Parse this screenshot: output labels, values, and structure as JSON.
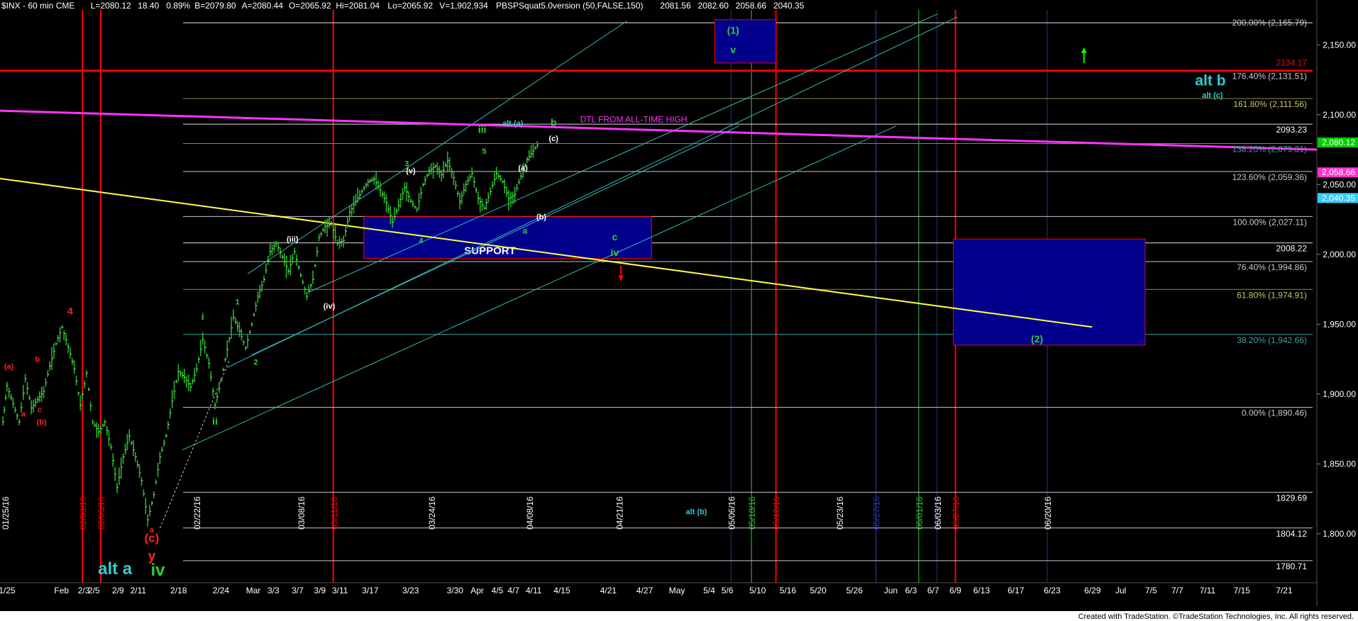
{
  "header": {
    "segments": [
      {
        "text": "$INX - 60 min  CME",
        "color": "#ffffff"
      },
      {
        "text": "L=2080.12",
        "color": "#ffffff"
      },
      {
        "text": "18.40",
        "color": "#ffffff"
      },
      {
        "text": "0.89%",
        "color": "#ffffff"
      },
      {
        "text": "B=2079.80",
        "color": "#ffffff"
      },
      {
        "text": "A=2080.44",
        "color": "#ffffff"
      },
      {
        "text": "O=2065.92",
        "color": "#ffffff"
      },
      {
        "text": "Hi=2081.04",
        "color": "#ffffff"
      },
      {
        "text": "Lo=2065.92",
        "color": "#ffffff"
      },
      {
        "text": "V=1,902,934",
        "color": "#ffffff"
      },
      {
        "text": "PBSPSquat5.0version (50,FALSE,150)",
        "color": "#ffffff"
      },
      {
        "text": "2081.56",
        "color": "#33ccff"
      },
      {
        "text": "2082.60",
        "color": "#cccc00"
      },
      {
        "text": "2058.66",
        "color": "#ff33cc"
      },
      {
        "text": "2040.35",
        "color": "#33ccff"
      }
    ]
  },
  "footer": {
    "text": "Created with TradeStation. ©TradeStation Technologies, Inc. All rights reserved."
  },
  "chart_data": {
    "type": "candlestick",
    "symbol": "$INX",
    "interval": "60 min",
    "ylim": [
      1770,
      2175
    ],
    "y_ticks": [
      "2,150.00",
      "2,100.00",
      "2,050.00",
      "2,000.00",
      "1,950.00",
      "1,900.00",
      "1,850.00",
      "1,800.00"
    ],
    "y_tick_values": [
      2150,
      2100,
      2050,
      2000,
      1950,
      1900,
      1850,
      1800
    ],
    "x_tick_labels": [
      "1/25",
      "Feb",
      "2/3",
      "2/5",
      "2/9",
      "2/11",
      "2/18",
      "2/24",
      "Mar",
      "3/3",
      "3/7",
      "3/9",
      "3/11",
      "3/17",
      "3/23",
      "3/30",
      "Apr",
      "4/5",
      "4/7",
      "4/11",
      "4/15",
      "4/21",
      "4/27",
      "May",
      "5/4",
      "5/6",
      "5/10",
      "5/16",
      "5/20",
      "5/26",
      "Jun",
      "6/3",
      "6/7",
      "6/9",
      "6/13",
      "6/17",
      "6/23",
      "6/29",
      "Jul",
      "7/5",
      "7/7",
      "7/11",
      "7/15",
      "7/21"
    ],
    "price_path": [
      {
        "d": 0,
        "p": 1880
      },
      {
        "d": 2,
        "p": 1906
      },
      {
        "d": 5,
        "p": 1893
      },
      {
        "d": 8,
        "p": 1880
      },
      {
        "d": 11,
        "p": 1911
      },
      {
        "d": 14,
        "p": 1890
      },
      {
        "d": 17,
        "p": 1896
      },
      {
        "d": 20,
        "p": 1902
      },
      {
        "d": 23,
        "p": 1920
      },
      {
        "d": 26,
        "p": 1936
      },
      {
        "d": 29,
        "p": 1948
      },
      {
        "d": 32,
        "p": 1934
      },
      {
        "d": 35,
        "p": 1918
      },
      {
        "d": 38,
        "p": 1892
      },
      {
        "d": 41,
        "p": 1915
      },
      {
        "d": 44,
        "p": 1880
      },
      {
        "d": 47,
        "p": 1873
      },
      {
        "d": 50,
        "p": 1880
      },
      {
        "d": 53,
        "p": 1862
      },
      {
        "d": 56,
        "p": 1833
      },
      {
        "d": 59,
        "p": 1855
      },
      {
        "d": 62,
        "p": 1870
      },
      {
        "d": 65,
        "p": 1855
      },
      {
        "d": 68,
        "p": 1838
      },
      {
        "d": 71,
        "p": 1810
      },
      {
        "d": 74,
        "p": 1828
      },
      {
        "d": 77,
        "p": 1855
      },
      {
        "d": 80,
        "p": 1870
      },
      {
        "d": 83,
        "p": 1895
      },
      {
        "d": 86,
        "p": 1916
      },
      {
        "d": 89,
        "p": 1912
      },
      {
        "d": 92,
        "p": 1905
      },
      {
        "d": 95,
        "p": 1918
      },
      {
        "d": 98,
        "p": 1939
      },
      {
        "d": 101,
        "p": 1922
      },
      {
        "d": 104,
        "p": 1892
      },
      {
        "d": 107,
        "p": 1910
      },
      {
        "d": 110,
        "p": 1932
      },
      {
        "d": 113,
        "p": 1955
      },
      {
        "d": 116,
        "p": 1945
      },
      {
        "d": 119,
        "p": 1933
      },
      {
        "d": 122,
        "p": 1950
      },
      {
        "d": 125,
        "p": 1970
      },
      {
        "d": 128,
        "p": 1982
      },
      {
        "d": 131,
        "p": 2002
      },
      {
        "d": 134,
        "p": 2008
      },
      {
        "d": 137,
        "p": 1998
      },
      {
        "d": 140,
        "p": 1988
      },
      {
        "d": 143,
        "p": 2002
      },
      {
        "d": 146,
        "p": 1985
      },
      {
        "d": 149,
        "p": 1970
      },
      {
        "d": 152,
        "p": 1982
      },
      {
        "d": 155,
        "p": 2012
      },
      {
        "d": 158,
        "p": 2020
      },
      {
        "d": 161,
        "p": 2022
      },
      {
        "d": 164,
        "p": 2008
      },
      {
        "d": 167,
        "p": 2010
      },
      {
        "d": 170,
        "p": 2030
      },
      {
        "d": 173,
        "p": 2038
      },
      {
        "d": 176,
        "p": 2045
      },
      {
        "d": 179,
        "p": 2052
      },
      {
        "d": 182,
        "p": 2054
      },
      {
        "d": 185,
        "p": 2046
      },
      {
        "d": 188,
        "p": 2037
      },
      {
        "d": 191,
        "p": 2023
      },
      {
        "d": 194,
        "p": 2035
      },
      {
        "d": 197,
        "p": 2048
      },
      {
        "d": 200,
        "p": 2038
      },
      {
        "d": 203,
        "p": 2032
      },
      {
        "d": 206,
        "p": 2050
      },
      {
        "d": 209,
        "p": 2060
      },
      {
        "d": 212,
        "p": 2063
      },
      {
        "d": 215,
        "p": 2057
      },
      {
        "d": 218,
        "p": 2067
      },
      {
        "d": 221,
        "p": 2055
      },
      {
        "d": 224,
        "p": 2038
      },
      {
        "d": 227,
        "p": 2050
      },
      {
        "d": 230,
        "p": 2058
      },
      {
        "d": 233,
        "p": 2040
      },
      {
        "d": 236,
        "p": 2033
      },
      {
        "d": 239,
        "p": 2045
      },
      {
        "d": 242,
        "p": 2058
      },
      {
        "d": 245,
        "p": 2052
      },
      {
        "d": 248,
        "p": 2040
      },
      {
        "d": 251,
        "p": 2043
      },
      {
        "d": 254,
        "p": 2056
      },
      {
        "d": 257,
        "p": 2068
      },
      {
        "d": 260,
        "p": 2074
      },
      {
        "d": 263,
        "p": 2080
      }
    ],
    "fib_levels": [
      {
        "label": "200.00% (2,165.79)",
        "value": 2165.79,
        "color": "#c8c8c8",
        "line": "#e8e8e8"
      },
      {
        "label": "176.40% (2,131.51)",
        "value": 2131.51,
        "color": "#c8c8c8",
        "line": "#ff0000"
      },
      {
        "label": "161.80% (2,111.56)",
        "value": 2111.56,
        "color": "#c8c864",
        "line": "#8c8c50"
      },
      {
        "label": "2093.23",
        "value": 2093.23,
        "color": "#ffffff",
        "line": "#dcdcdc"
      },
      {
        "label": "138.20% (2,079.31)",
        "value": 2079.31,
        "color": "#46a0a0",
        "line": "#46a0a0"
      },
      {
        "label": "123.60% (2,059.36)",
        "value": 2059.36,
        "color": "#c8c8c8",
        "line": "#c8c8c8"
      },
      {
        "label": "100.00% (2,027.11)",
        "value": 2027.11,
        "color": "#c8c8c8",
        "line": "#c8c8c8"
      },
      {
        "label": "2008.22",
        "value": 2008.22,
        "color": "#ffffff",
        "line": "#dcdcdc"
      },
      {
        "label": "76.40% (1,994.86)",
        "value": 1994.86,
        "color": "#c8c8c8",
        "line": "#c8c8c8"
      },
      {
        "label": "61.80% (1,974.91)",
        "value": 1974.91,
        "color": "#c8c864",
        "line": "#8c8c50"
      },
      {
        "label": "38.20% (1,942.66)",
        "value": 1942.66,
        "color": "#46a0a0",
        "line": "#46a0a0"
      },
      {
        "label": "0.00% (1,890.46)",
        "value": 1890.46,
        "color": "#c8c8c8",
        "line": "#c8c8c8"
      },
      {
        "label": "1829.69",
        "value": 1829.69,
        "color": "#ffffff",
        "line": "#c8c8c8"
      },
      {
        "label": "1804.12",
        "value": 1804.12,
        "color": "#ffffff",
        "line": "#c8c8c8"
      },
      {
        "label": "1780.71",
        "value": 1780.71,
        "color": "#ffffff",
        "line": "#c8c8c8"
      }
    ],
    "price_markers": [
      {
        "text": "2,080.12",
        "value": 2080.12,
        "bg": "#00cc00",
        "fg": "#000000"
      },
      {
        "text": "2,058.66",
        "value": 2058.66,
        "bg": "#ff33cc",
        "fg": "#000000"
      },
      {
        "text": "2,040.35",
        "value": 2040.35,
        "bg": "#33ccff",
        "fg": "#000000"
      }
    ],
    "red_level_label": {
      "text": "2134.17",
      "value": 2134.17,
      "color": "#ff0000"
    },
    "vertical_date_markers": [
      {
        "text": "01/25/16",
        "d": 0,
        "color": "#ffffff",
        "line": null
      },
      {
        "text": "02/03/16",
        "d": 39,
        "color": "#ff0000",
        "line": "#ff0000"
      },
      {
        "text": "02/05/16",
        "d": 48,
        "color": "#ff0000",
        "line": "#ff0000"
      },
      {
        "text": "02/22/16",
        "d": 95,
        "color": "#ffffff",
        "line": null
      },
      {
        "text": "03/08/16",
        "d": 146,
        "color": "#ffffff",
        "line": null
      },
      {
        "text": "03/11/16",
        "d": 162,
        "color": "#ff0000",
        "line": "#ff0000"
      },
      {
        "text": "03/24/16",
        "d": 210,
        "color": "#ffffff",
        "line": null
      },
      {
        "text": "04/08/16",
        "d": 258,
        "color": "#ffffff",
        "line": null
      },
      {
        "text": "04/21/16",
        "d": 302,
        "color": "#ffffff",
        "line": null
      },
      {
        "text": "05/06/16",
        "d": 357,
        "color": "#ffffff",
        "line": "#1a3a8a"
      },
      {
        "text": "05/10/16",
        "d": 367,
        "color": "#33cc33",
        "line": "#33cc33"
      },
      {
        "text": "05/12/16",
        "d": 379,
        "color": "#ff0000",
        "line": "#ff0000"
      },
      {
        "text": "05/23/16",
        "d": 410,
        "color": "#ffffff",
        "line": null
      },
      {
        "text": "05/27/16",
        "d": 428,
        "color": "#3333cc",
        "line": "#3333cc"
      },
      {
        "text": "06/01/16",
        "d": 449,
        "color": "#33cc33",
        "line": "#33cc33"
      },
      {
        "text": "06/03/16",
        "d": 458,
        "color": "#ffffff",
        "line": "#1a3a8a"
      },
      {
        "text": "06/07/16",
        "d": 467,
        "color": "#ff0000",
        "line": "#ff0000"
      },
      {
        "text": "06/20/16",
        "d": 512,
        "color": "#ffffff",
        "line": "#1a3a8a"
      }
    ],
    "zones": [
      {
        "name": "support-zone",
        "label": "SUPPORT",
        "d0": 177,
        "d1": 318,
        "p0": 1997,
        "p1": 2027,
        "fill": "#00008b",
        "stroke": "#ff0000"
      },
      {
        "name": "wave-1-target-zone",
        "label": "",
        "d0": 349,
        "d1": 379,
        "p0": 2137,
        "p1": 2168,
        "fill": "#00008b",
        "stroke": "#ff0000"
      },
      {
        "name": "wave-2-target-zone",
        "label": "",
        "d0": 466,
        "d1": 560,
        "p0": 1935,
        "p1": 2011,
        "fill": "#00008b",
        "stroke": "#ff0000"
      }
    ],
    "trend_lines": [
      {
        "name": "dtl-from-all-time-high",
        "label": "DTL FROM ALL-TIME HIGH",
        "d0": -5,
        "p0": 2103,
        "d1": 665,
        "p1": 2075,
        "color": "#ff33ff",
        "width": 3
      },
      {
        "name": "yellow-trendline",
        "label": "",
        "d0": -5,
        "p0": 2055,
        "d1": 534,
        "p1": 1948,
        "color": "#ffff44",
        "width": 2
      }
    ],
    "channel_lines": [
      {
        "d0": 120,
        "p0": 1986,
        "d1": 306,
        "p1": 2167
      },
      {
        "d0": 150,
        "p0": 1973,
        "d1": 458,
        "p1": 2172
      },
      {
        "d0": 110,
        "p0": 1919,
        "d1": 468,
        "p1": 2170
      },
      {
        "d0": 122,
        "p0": 1928,
        "d1": 361,
        "p1": 2092
      },
      {
        "d0": 88,
        "p0": 1860,
        "d1": 438,
        "p1": 2092
      }
    ],
    "arrows": [
      {
        "name": "down-arrow",
        "d": 303,
        "p": 1992,
        "dir": "down",
        "color": "#ff0000"
      },
      {
        "name": "up-arrow",
        "d": 530,
        "p": 2137,
        "dir": "up",
        "color": "#00ff00"
      }
    ],
    "wave_labels": [
      {
        "text": "(a)",
        "d": 3,
        "p": 1918,
        "color": "#ff2222",
        "size": 11
      },
      {
        "text": "b",
        "d": 17,
        "p": 1923,
        "color": "#ff2222",
        "size": 11
      },
      {
        "text": "a",
        "d": 10,
        "p": 1884,
        "color": "#ff2222",
        "size": 11
      },
      {
        "text": "c",
        "d": 18,
        "p": 1887,
        "color": "#ff2222",
        "size": 11
      },
      {
        "text": "(b)",
        "d": 19,
        "p": 1878,
        "color": "#ff2222",
        "size": 11
      },
      {
        "text": "4",
        "d": 33,
        "p": 1957,
        "color": "#ff2222",
        "size": 14
      },
      {
        "text": "a",
        "d": 73,
        "p": 1801,
        "color": "#ff2222",
        "size": 11
      },
      {
        "text": "(c)",
        "d": 73,
        "p": 1794,
        "color": "#ff2222",
        "size": 17
      },
      {
        "text": "y",
        "d": 73,
        "p": 1781,
        "color": "#ff2222",
        "size": 19
      },
      {
        "text": "iv",
        "d": 76,
        "p": 1770,
        "color": "#33cc33",
        "size": 24
      },
      {
        "text": "alt a",
        "d": 55,
        "p": 1771,
        "color": "#33cccc",
        "size": 24
      },
      {
        "text": "alt b",
        "d": 592,
        "p": 2121,
        "color": "#33cccc",
        "size": 21
      },
      {
        "text": "alt (c)",
        "d": 593,
        "p": 2112,
        "color": "#33cccc",
        "size": 11
      },
      {
        "text": "i",
        "d": 98,
        "p": 1953,
        "color": "#33cc33",
        "size": 14
      },
      {
        "text": "ii",
        "d": 104,
        "p": 1878,
        "color": "#33cc33",
        "size": 14
      },
      {
        "text": "1",
        "d": 115,
        "p": 1964,
        "color": "#33cc33",
        "size": 11
      },
      {
        "text": "2",
        "d": 124,
        "p": 1921,
        "color": "#33cc33",
        "size": 11
      },
      {
        "text": "(iii)",
        "d": 142,
        "p": 2009,
        "color": "#ffffff",
        "size": 11
      },
      {
        "text": "(iv)",
        "d": 160,
        "p": 1961,
        "color": "#ffffff",
        "size": 11
      },
      {
        "text": "3",
        "d": 198,
        "p": 2063,
        "color": "#33cc33",
        "size": 11
      },
      {
        "text": "(v)",
        "d": 200,
        "p": 2058,
        "color": "#ffffff",
        "size": 11
      },
      {
        "text": "4",
        "d": 205,
        "p": 2008,
        "color": "#33cc33",
        "size": 11
      },
      {
        "text": "iii",
        "d": 235,
        "p": 2087,
        "color": "#33cc33",
        "size": 14
      },
      {
        "text": "5",
        "d": 236,
        "p": 2072,
        "color": "#33cc33",
        "size": 11
      },
      {
        "text": "alt (a)",
        "d": 250,
        "p": 2092,
        "color": "#33cccc",
        "size": 11
      },
      {
        "text": "(a)",
        "d": 255,
        "p": 2060,
        "color": "#ffffff",
        "size": 11
      },
      {
        "text": "(b)",
        "d": 264,
        "p": 2025,
        "color": "#ffffff",
        "size": 11
      },
      {
        "text": "a",
        "d": 256,
        "p": 2015,
        "color": "#33cc33",
        "size": 12
      },
      {
        "text": "b",
        "d": 270,
        "p": 2092,
        "color": "#33cc33",
        "size": 14
      },
      {
        "text": "(c)",
        "d": 270,
        "p": 2081,
        "color": "#ffffff",
        "size": 11
      },
      {
        "text": "c",
        "d": 300,
        "p": 2010,
        "color": "#33cc33",
        "size": 14
      },
      {
        "text": "iv",
        "d": 300,
        "p": 1999,
        "color": "#33cc33",
        "size": 14
      },
      {
        "text": "(1)",
        "d": 358,
        "p": 2158,
        "color": "#33cc33",
        "size": 14
      },
      {
        "text": "v",
        "d": 358,
        "p": 2144,
        "color": "#33cc33",
        "size": 14
      },
      {
        "text": "(2)",
        "d": 507,
        "p": 1937,
        "color": "#33cc33",
        "size": 14
      },
      {
        "text": "alt (b)",
        "d": 340,
        "p": 1814,
        "color": "#33cccc",
        "size": 11
      },
      {
        "text": ")",
        "d": -2,
        "p": 1806,
        "color": "#ff2222",
        "size": 12
      }
    ]
  }
}
